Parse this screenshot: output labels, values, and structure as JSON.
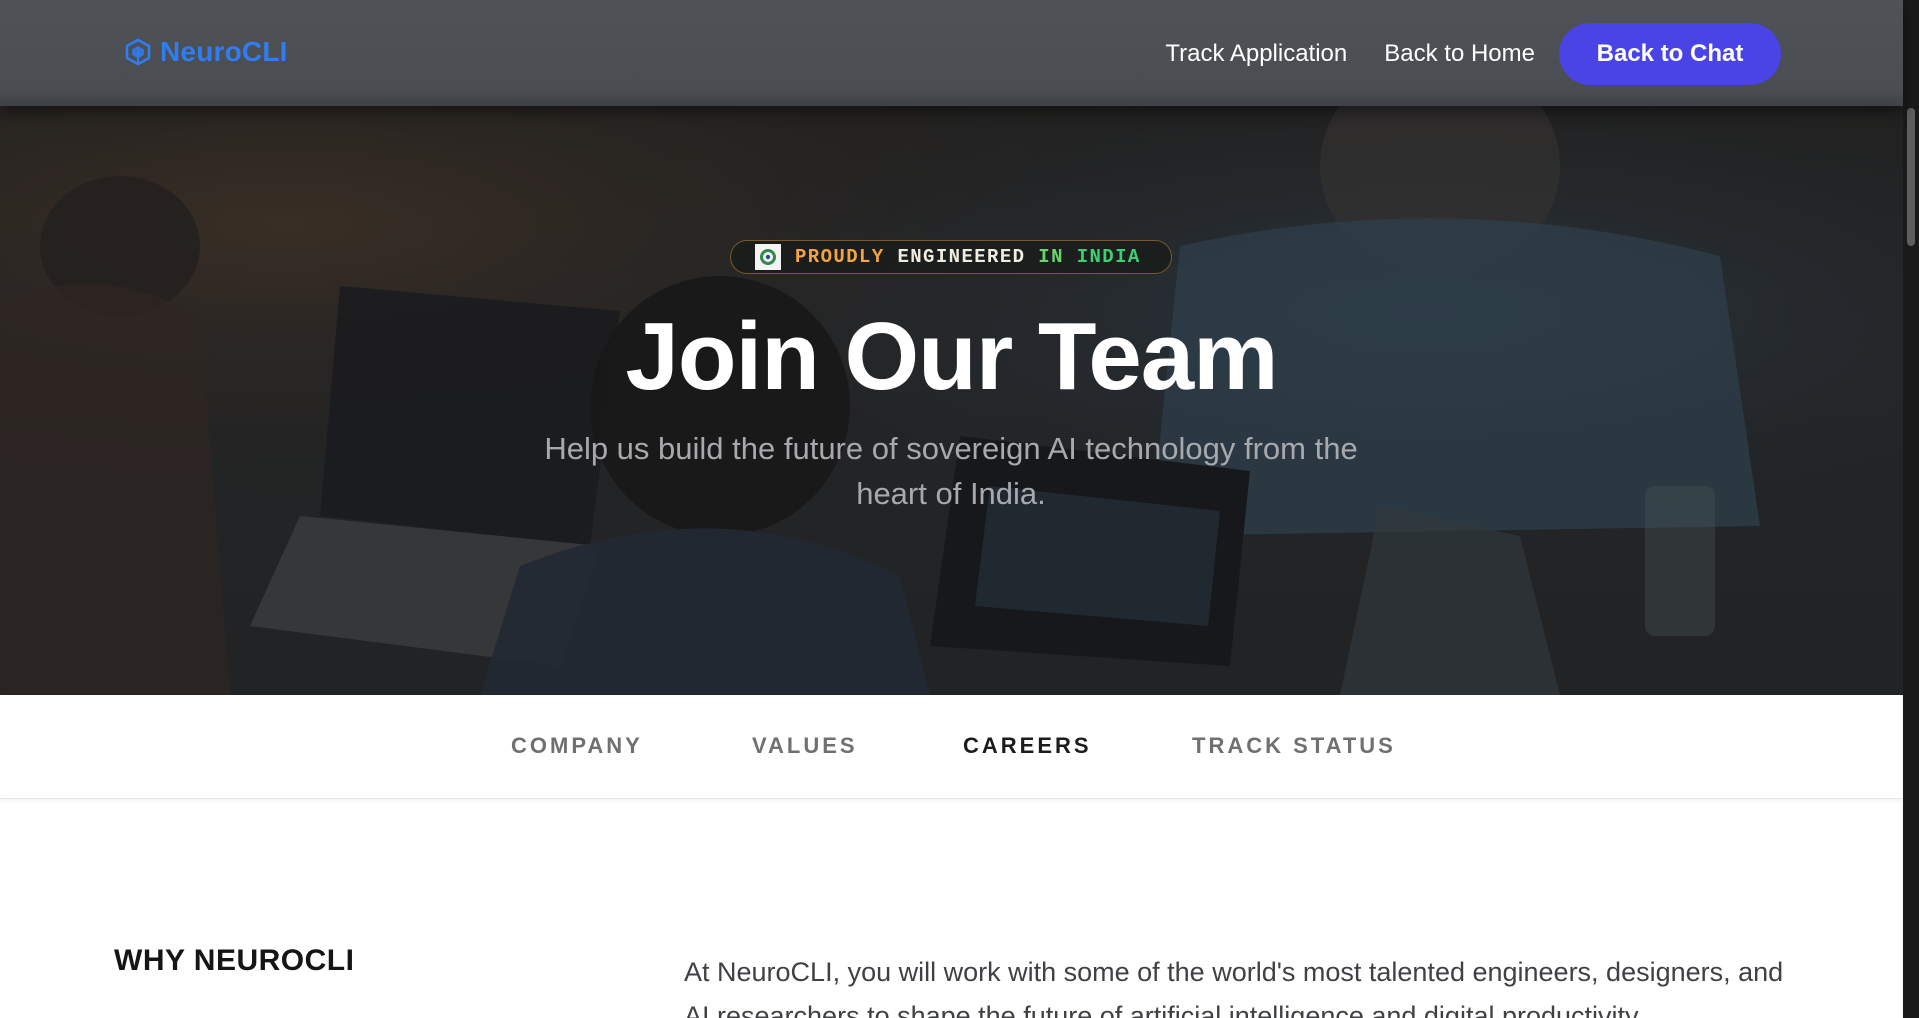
{
  "header": {
    "brand_name": "NeuroCLI",
    "brand_icon": "cube-logo-icon",
    "nav": {
      "track_application": "Track Application",
      "back_to_home": "Back to Home",
      "back_to_chat": "Back to Chat"
    }
  },
  "hero": {
    "badge": {
      "flag_icon": "india-emblem-icon",
      "word1": "PROUDLY",
      "word2": "ENGINEERED",
      "word3": "IN",
      "word4": "INDIA"
    },
    "title": "Join Our Team",
    "subtitle": "Help us build the future of sovereign AI technology from the heart of India."
  },
  "tabs": {
    "company": "COMPANY",
    "values": "VALUES",
    "careers": "CAREERS",
    "track_status": "TRACK STATUS",
    "active": "CAREERS"
  },
  "why": {
    "heading": "WHY NEUROCLI",
    "body": "At NeuroCLI, you will work with some of the world's most talented engineers, designers, and AI researchers to shape the future of artificial intelligence and digital productivity."
  },
  "colors": {
    "brand": "#2f7df0",
    "primary_button": "#4a44e6",
    "badge_orange": "#f4a340",
    "badge_green": "#3fcf73"
  }
}
